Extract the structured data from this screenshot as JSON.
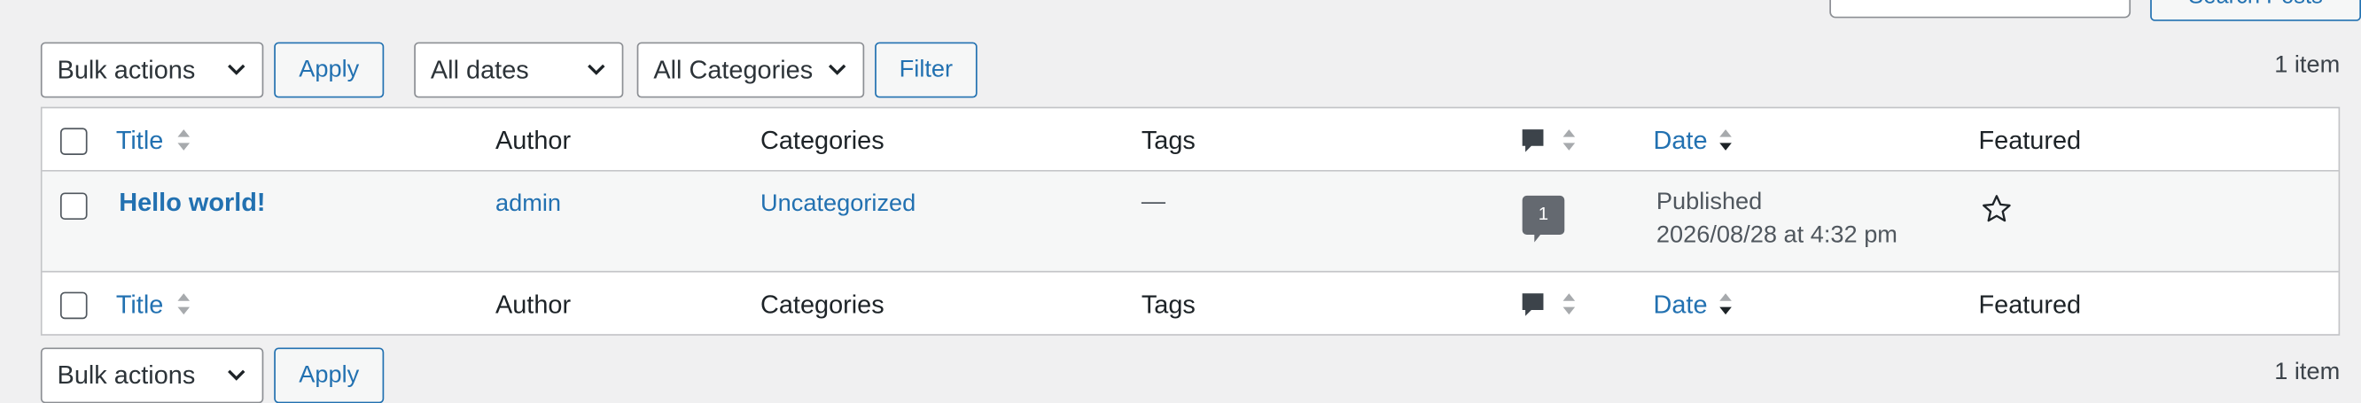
{
  "top": {
    "search_button_label": "Search Posts"
  },
  "tablenav_top": {
    "bulk_actions": "Bulk actions",
    "apply_label": "Apply",
    "dates_filter": "All dates",
    "categories_filter": "All Categories",
    "filter_label": "Filter",
    "items_count": "1 item"
  },
  "columns": {
    "title": "Title",
    "author": "Author",
    "categories": "Categories",
    "tags": "Tags",
    "date": "Date",
    "featured": "Featured"
  },
  "posts": [
    {
      "title": "Hello world!",
      "author": "admin",
      "categories": "Uncategorized",
      "tags": "—",
      "comments": "1",
      "status": "Published",
      "date": "2026/08/28 at 4:32 pm",
      "featured_icon": "star-outline-icon"
    }
  ],
  "tablenav_bottom": {
    "bulk_actions": "Bulk actions",
    "apply_label": "Apply",
    "items_count": "1 item"
  },
  "colors": {
    "link": "#2271b1",
    "background": "#f0f0f1",
    "border": "#c3c4c7"
  }
}
